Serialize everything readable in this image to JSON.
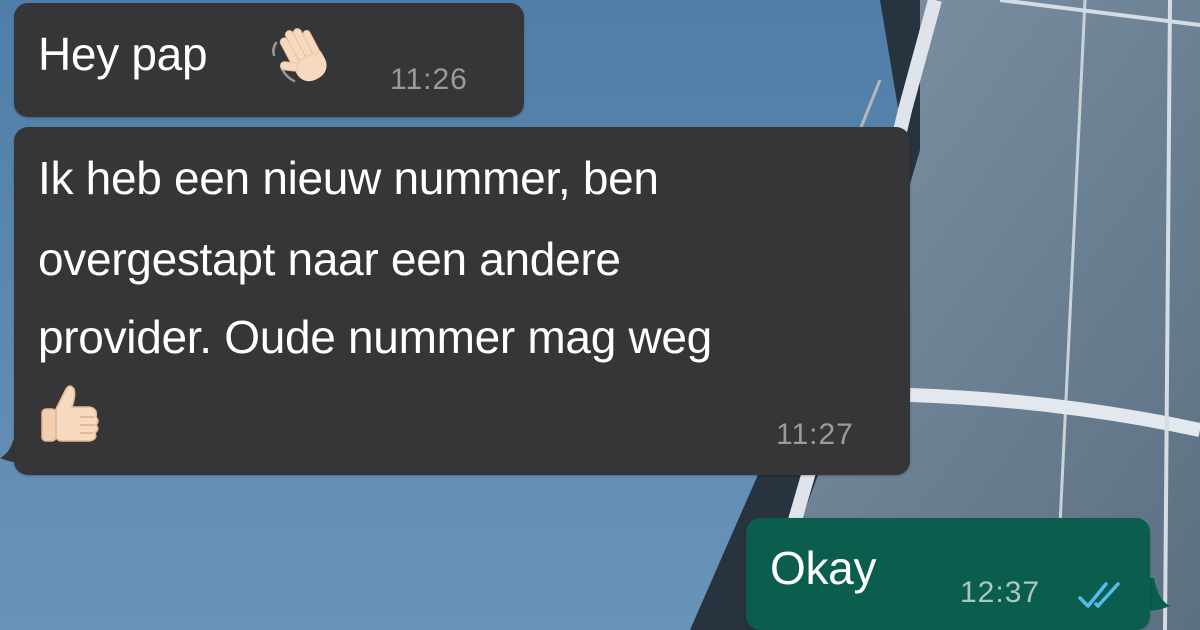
{
  "chat": {
    "messages": [
      {
        "direction": "incoming",
        "text": "Hey pap",
        "emoji": "waving-hand",
        "time": "11:26"
      },
      {
        "direction": "incoming",
        "lines": [
          "Ik heb een nieuw nummer, ben",
          "overgestapt naar een andere",
          "provider. Oude nummer mag weg"
        ],
        "emoji": "thumbs-up",
        "time": "11:27"
      },
      {
        "direction": "outgoing",
        "text": "Okay",
        "time": "12:37",
        "status_icon": "double-check-icon"
      }
    ]
  },
  "colors": {
    "incoming_bubble": "#363638",
    "outgoing_bubble": "#0b5d4e",
    "read_check": "#53bdeb",
    "wallpaper_sky": "#5b86ad"
  }
}
